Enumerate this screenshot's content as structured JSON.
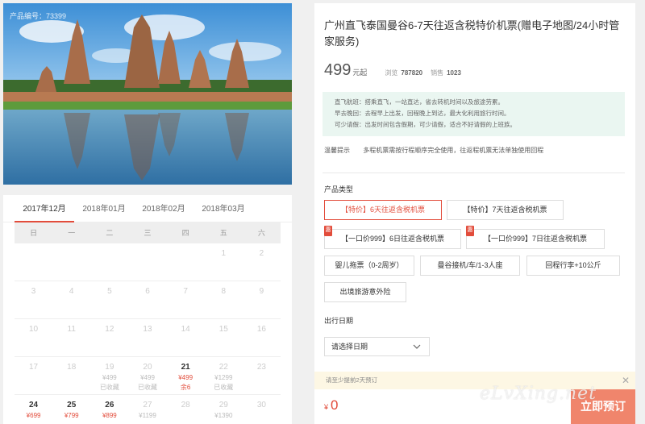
{
  "photo": {
    "caption": "产品编号：73399"
  },
  "calendar": {
    "months": [
      "2017年12月",
      "2018年01月",
      "2018年02月",
      "2018年03月"
    ],
    "active_month_index": 0,
    "weekdays": [
      "日",
      "一",
      "二",
      "三",
      "四",
      "五",
      "六"
    ],
    "weeks": [
      [
        {
          "n": ""
        },
        {
          "n": ""
        },
        {
          "n": ""
        },
        {
          "n": ""
        },
        {
          "n": ""
        },
        {
          "n": "1"
        },
        {
          "n": "2"
        }
      ],
      [
        {
          "n": "3"
        },
        {
          "n": "4"
        },
        {
          "n": "5"
        },
        {
          "n": "6"
        },
        {
          "n": "7"
        },
        {
          "n": "8"
        },
        {
          "n": "9"
        }
      ],
      [
        {
          "n": "10"
        },
        {
          "n": "11"
        },
        {
          "n": "12"
        },
        {
          "n": "13"
        },
        {
          "n": "14"
        },
        {
          "n": "15"
        },
        {
          "n": "16"
        }
      ],
      [
        {
          "n": "17"
        },
        {
          "n": "18"
        },
        {
          "n": "19",
          "p": "¥499",
          "s": "已收藏"
        },
        {
          "n": "20",
          "p": "¥499",
          "s": "已收藏"
        },
        {
          "n": "21",
          "p": "¥499",
          "s": "余6",
          "hot": true
        },
        {
          "n": "22",
          "p": "¥1299",
          "s": "已收藏"
        },
        {
          "n": "23"
        }
      ],
      [
        {
          "n": "24",
          "p": "¥699",
          "hot": true
        },
        {
          "n": "25",
          "p": "¥799",
          "hot": true
        },
        {
          "n": "26",
          "p": "¥899",
          "hot": true
        },
        {
          "n": "27",
          "p": "¥1199"
        },
        {
          "n": "28"
        },
        {
          "n": "29",
          "p": "¥1390"
        },
        {
          "n": "30"
        }
      ]
    ]
  },
  "product": {
    "title": "广州直飞泰国曼谷6-7天往返含税特价机票(赠电子地图/24小时管家服务)",
    "price": "499",
    "price_unit": "元起",
    "views_label": "浏览",
    "views": "787820",
    "sales_label": "销售",
    "sales": "1023",
    "info_lines": [
      "直飞航班：搭乘直飞，一站直达，省去转机时间以及旅途劳累。",
      "早去晚回：去程早上出发，回程晚上到达，最大化利用旅行时间。",
      "可少请假：出发时间包含假期，可少请假，适合不好请假的上班族。"
    ],
    "tip_label": "温馨提示",
    "tip_text": "多程机票需按行程顺序完全使用，往返程机票无法单独使用回程"
  },
  "options": {
    "label": "产品类型",
    "items": [
      {
        "label": "【特价】6天往返含税机票",
        "selected": true
      },
      {
        "label": "【特价】7天往返含税机票"
      },
      {
        "label": "【一口价999】6日往返含税机票",
        "tag": "惠"
      },
      {
        "label": "【一口价999】7日往返含税机票",
        "tag": "惠"
      },
      {
        "label": "婴儿拖票（0-2周岁）"
      },
      {
        "label": "曼谷接机/车/1-3人座"
      },
      {
        "label": "回程行李+10公斤"
      },
      {
        "label": "出境旅游意外险"
      }
    ]
  },
  "date": {
    "label": "出行日期",
    "placeholder": "请选择日期"
  },
  "notice": {
    "text": "请至少提前2天预订",
    "close": "✕"
  },
  "total": {
    "currency": "¥",
    "amount": "0"
  },
  "book_button": "立即预订",
  "watermark": "eLvXing.net",
  "colors": {
    "accent": "#e24c3b",
    "book_button": "#f0856c",
    "info_bg": "#eaf6f1",
    "notice_bg": "#fdf7e4"
  }
}
